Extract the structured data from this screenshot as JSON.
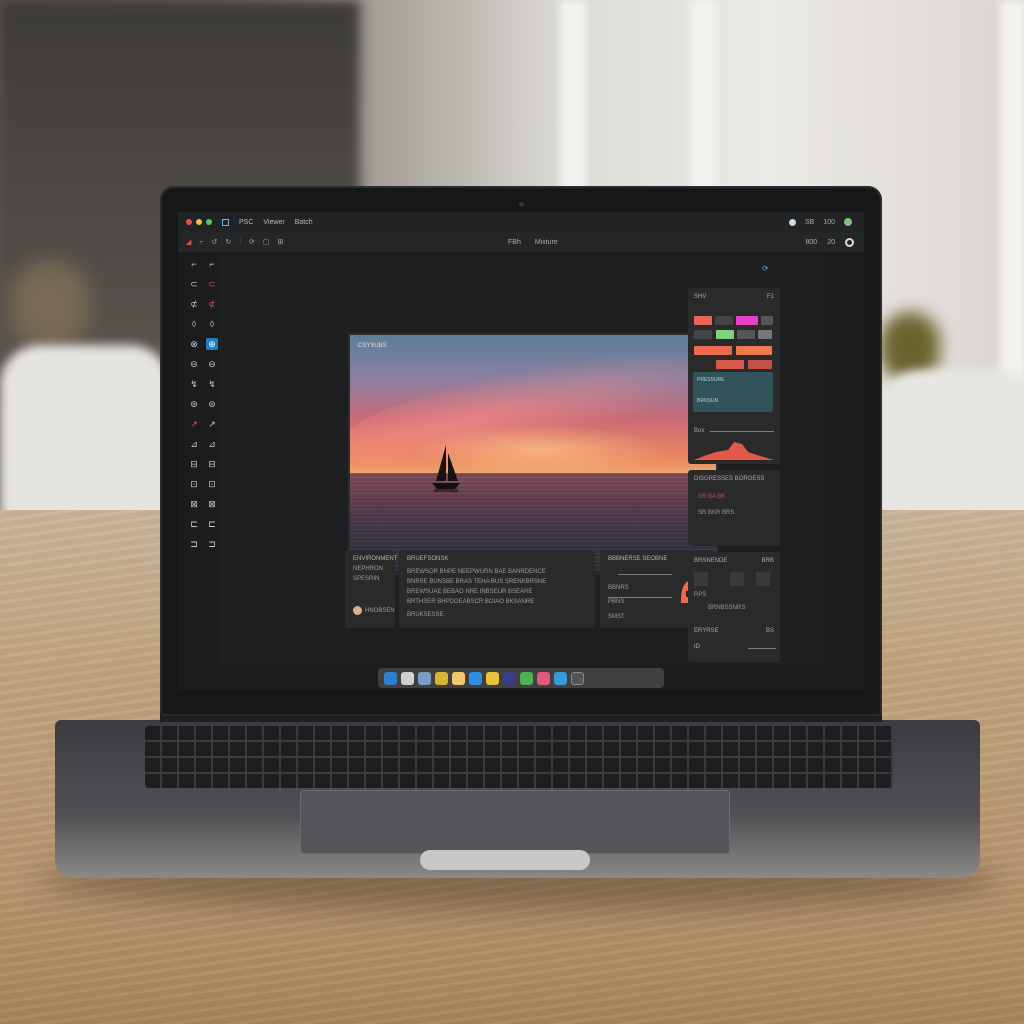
{
  "menubar": {
    "items": [
      "PSC",
      "Viewer",
      "Batch"
    ],
    "right": [
      "SB",
      "100"
    ]
  },
  "toolbar": {
    "center_left": "FBh",
    "center_right": "Mixture",
    "right_a": "800",
    "right_b": "20"
  },
  "photo": {
    "caption": "CSYSUBS"
  },
  "panels": {
    "left_small": {
      "title": "ENVIRONMENT",
      "line_a": "NEPHRON",
      "line_b": "SPESRIN",
      "footer": "HNOBSEN"
    },
    "center_text": {
      "title": "BRUEFSONSK",
      "lines": [
        "BREWSOR BNPE NEEPWURN BAE BANRDENCE",
        "BNRSE BUNSBE BRAS TEHA BUS SRENKBRSNE",
        "BREWSUAE BEBAO NRE INBSEUR BSEARE",
        "BRTHSER BHPDOEABSCR BOIAO BKSANRE",
        "BRUKSESSE"
      ]
    },
    "center_right": {
      "title": "BBBNERSE SEOBNE",
      "row_a": "BBNRS",
      "row_b": "PBNS",
      "footer": "SMST"
    },
    "right_top": {
      "title": "SHV",
      "tag": "F1",
      "teal_a": "PRESSURE",
      "teal_b": "BRNSUN",
      "footer": "Box"
    },
    "right_mid": {
      "title": "DISGRESSES BOROESS",
      "row_a": "SR BA BK",
      "row_b": "SR BKR BRS"
    },
    "right_bottom": {
      "title": "BRSNENDE",
      "tag": "BRB",
      "row_a": "RPS",
      "row_b": "BRNBSSNRS",
      "footer_label": "ERYRSE",
      "footer_value": "BS",
      "footer_small": "ID"
    }
  },
  "colors": {
    "accent_blue": "#1a7fc4",
    "accent_red": "#e3504a",
    "accent_orange": "#ee6a4e",
    "accent_green": "#7fd07f",
    "accent_pink": "#e83ec8",
    "teal": "#33535a"
  },
  "dock": {
    "icons": [
      "finder-icon",
      "safari-icon",
      "app-icon",
      "photos-icon",
      "notes-icon",
      "mail-icon",
      "folder-icon",
      "lightroom-icon",
      "maps-icon",
      "music-icon",
      "store-icon",
      "trash-icon"
    ]
  }
}
